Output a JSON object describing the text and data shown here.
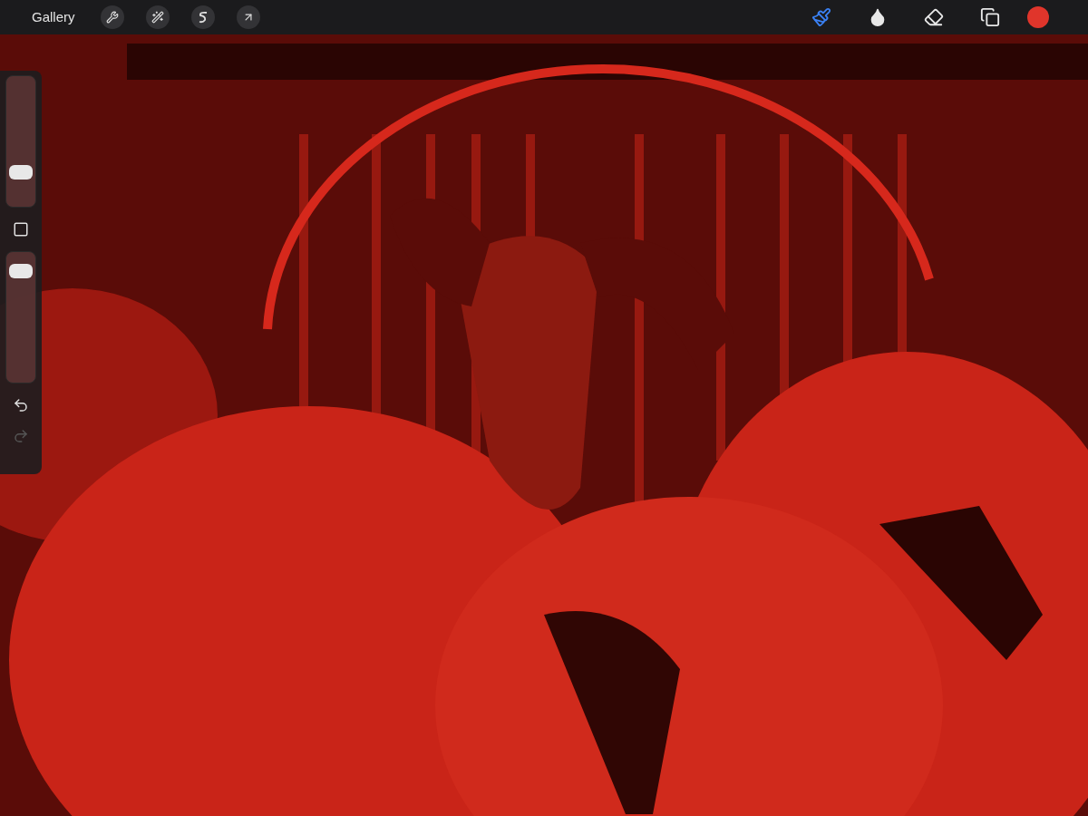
{
  "toolbar": {
    "gallery": "Gallery",
    "left_tools": [
      {
        "kind": "wrench"
      },
      {
        "kind": "wand"
      },
      {
        "kind": "selection"
      },
      {
        "kind": "transform"
      }
    ],
    "right_tools": [
      {
        "kind": "brush",
        "selected": true
      },
      {
        "kind": "smudge",
        "selected": false
      },
      {
        "kind": "eraser",
        "selected": false
      },
      {
        "kind": "layers",
        "selected": false
      }
    ],
    "color": "#e0352b"
  },
  "sidebar": {
    "size_slider": {
      "level": 0.24
    },
    "opacity_slider": {
      "level": 0.91
    },
    "undo": {
      "disabled": false
    },
    "redo": {
      "disabled": true
    }
  }
}
